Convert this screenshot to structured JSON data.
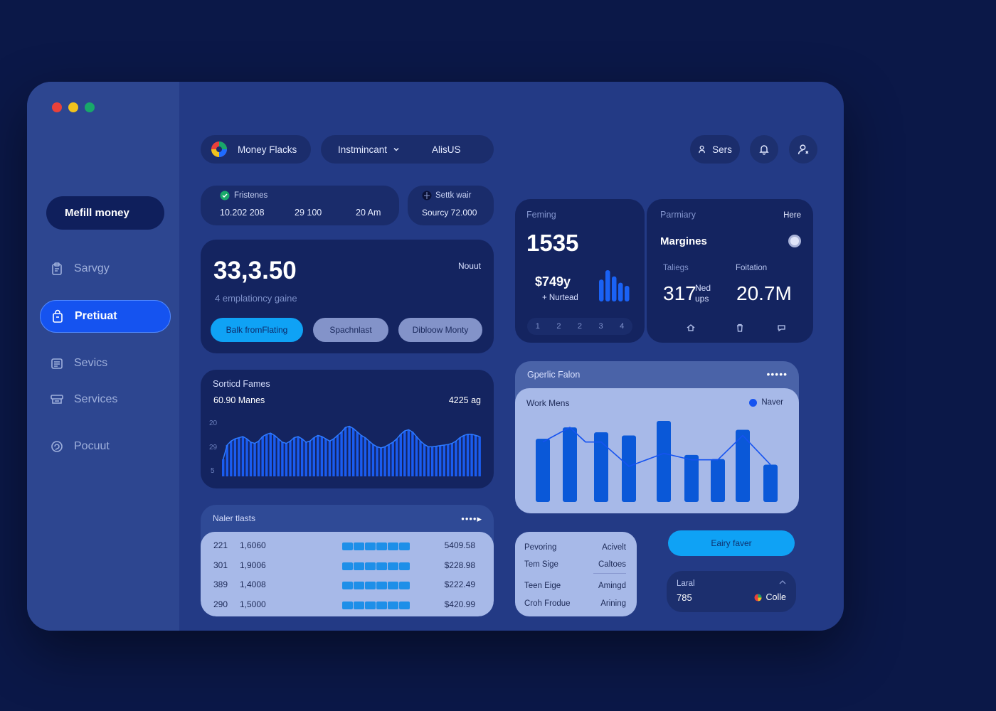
{
  "sidebar": {
    "primary_button": "Mefill money",
    "items": [
      {
        "label": "Sarvgy",
        "icon": "clipboard-icon"
      },
      {
        "label": "Pretiuat",
        "icon": "bag-icon"
      },
      {
        "label": "Sevics",
        "icon": "list-icon"
      },
      {
        "label": "Services",
        "icon": "stack-icon"
      },
      {
        "label": "Pocuut",
        "icon": "circle-arrow-icon"
      }
    ]
  },
  "header": {
    "brand": "Money Flacks",
    "menu_dropdown": "Instmincant",
    "menu_link": "AlisUS",
    "user_button": "Sers"
  },
  "summary": {
    "label": "Fristenes",
    "values": [
      "10.202 208",
      "29 100",
      "20 Am"
    ],
    "second_label": "Settk wair",
    "second_value": "Sourcy 72.000"
  },
  "balance": {
    "amount": "33,3.50",
    "tag": "Nouut",
    "subtitle": "4  emplationcy gaine",
    "buttons": [
      "Balk fromFlating",
      "Spachnlast",
      "Dibloow Monty"
    ]
  },
  "activity": {
    "title": "Sorticd Fames",
    "subtitle": "60.90 Manes",
    "right_value": "4225 ag",
    "y_ticks": [
      "20",
      "29",
      "5"
    ],
    "bars": [
      0.3,
      0.55,
      0.62,
      0.66,
      0.68,
      0.7,
      0.66,
      0.6,
      0.58,
      0.62,
      0.7,
      0.74,
      0.76,
      0.72,
      0.66,
      0.6,
      0.58,
      0.62,
      0.68,
      0.7,
      0.66,
      0.6,
      0.62,
      0.68,
      0.72,
      0.7,
      0.66,
      0.62,
      0.66,
      0.72,
      0.78,
      0.86,
      0.88,
      0.84,
      0.78,
      0.72,
      0.68,
      0.62,
      0.56,
      0.52,
      0.5,
      0.52,
      0.56,
      0.6,
      0.66,
      0.74,
      0.8,
      0.82,
      0.78,
      0.7,
      0.62,
      0.56,
      0.52,
      0.52,
      0.53,
      0.54,
      0.55,
      0.56,
      0.58,
      0.62,
      0.68,
      0.72,
      0.74,
      0.74,
      0.72,
      0.7
    ]
  },
  "table": {
    "title": "Naler tlasts",
    "rows": [
      {
        "id": "221",
        "qty": "1,6060",
        "amount": "5409.58"
      },
      {
        "id": "301",
        "qty": "1,9006",
        "amount": "$228.98"
      },
      {
        "id": "389",
        "qty": "1,4008",
        "amount": "$222.49"
      },
      {
        "id": "290",
        "qty": "1,5000",
        "amount": "$420.99"
      }
    ]
  },
  "stat1": {
    "label": "Feming",
    "value": "1535",
    "amount": "$749y",
    "note": "+ Nurtead",
    "bars": [
      0.7,
      1.0,
      0.8,
      0.6,
      0.5
    ],
    "pages": [
      "1",
      "2",
      "2",
      "3",
      "4"
    ]
  },
  "stat2": {
    "label": "Parmiary",
    "link": "Here",
    "title": "Margines",
    "col1_label": "Taliegs",
    "col1_value": "317",
    "col1_unit_top": "Ned",
    "col1_unit_bottom": "ups",
    "col2_label": "Foitation",
    "col2_value": "20.7M"
  },
  "bar_panel": {
    "title": "Gperlic Falon",
    "inner_title": "Work Mens",
    "legend": "Naver",
    "bars": [
      0.78,
      0.92,
      0.86,
      0.82,
      1.0,
      0.58,
      0.53,
      0.89,
      0.46
    ],
    "line": [
      0.74,
      0.92,
      0.74,
      0.74,
      0.44,
      0.6,
      0.52,
      0.52,
      0.82,
      0.46
    ]
  },
  "mini_table": {
    "rows": [
      {
        "left": "Pevoring",
        "right": "Acivelt"
      },
      {
        "left": "Tem Sige",
        "right": "Caltoes"
      },
      {
        "left": "Teen Eige",
        "right": "Amingd"
      },
      {
        "left": "Croh Frodue",
        "right": "Arining"
      }
    ]
  },
  "cta": {
    "label": "Eairy faver"
  },
  "level": {
    "label": "Laral",
    "value": "785",
    "tag": "Colle"
  },
  "colors": {
    "accent": "#1553f0",
    "cyan": "#0fa2f5",
    "background": "#0b1848",
    "red": "#e9413a",
    "yellow": "#f0c21d",
    "green": "#18a86a"
  }
}
